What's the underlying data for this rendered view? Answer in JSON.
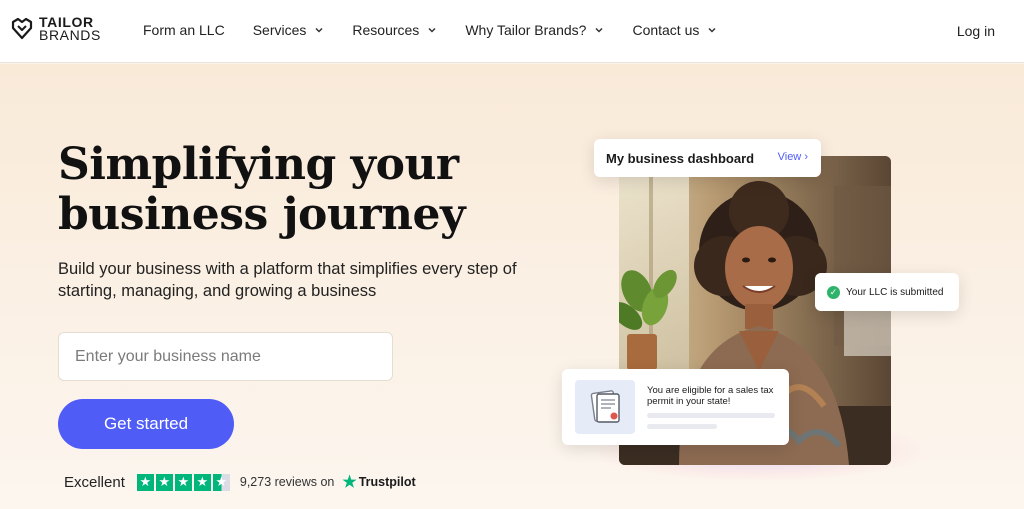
{
  "brand": {
    "line1": "TAILOR",
    "line2": "BRANDS"
  },
  "nav": {
    "items": [
      {
        "label": "Form an LLC",
        "has_dropdown": false
      },
      {
        "label": "Services",
        "has_dropdown": true
      },
      {
        "label": "Resources",
        "has_dropdown": true
      },
      {
        "label": "Why Tailor Brands?",
        "has_dropdown": true
      },
      {
        "label": "Contact us",
        "has_dropdown": true
      }
    ],
    "login": "Log in"
  },
  "hero": {
    "title_line1": "Simplifying your",
    "title_line2": "business journey",
    "subtitle": "Build your business with a platform that simplifies every step of starting, managing, and growing a business",
    "input_placeholder": "Enter your business name",
    "cta": "Get started"
  },
  "rating": {
    "label": "Excellent",
    "stars": 4.5,
    "reviews": "9,273 reviews on",
    "provider": "Trustpilot"
  },
  "cards": {
    "dashboard_title": "My business dashboard",
    "dashboard_link": "View",
    "llc_status": "Your LLC is submitted",
    "permit_text": "You are eligible for a sales tax permit in your state!"
  },
  "colors": {
    "accent": "#4f5cf6",
    "trustpilot": "#00b67a",
    "success": "#2eb36b",
    "hero_bg": "#f9ead8"
  }
}
